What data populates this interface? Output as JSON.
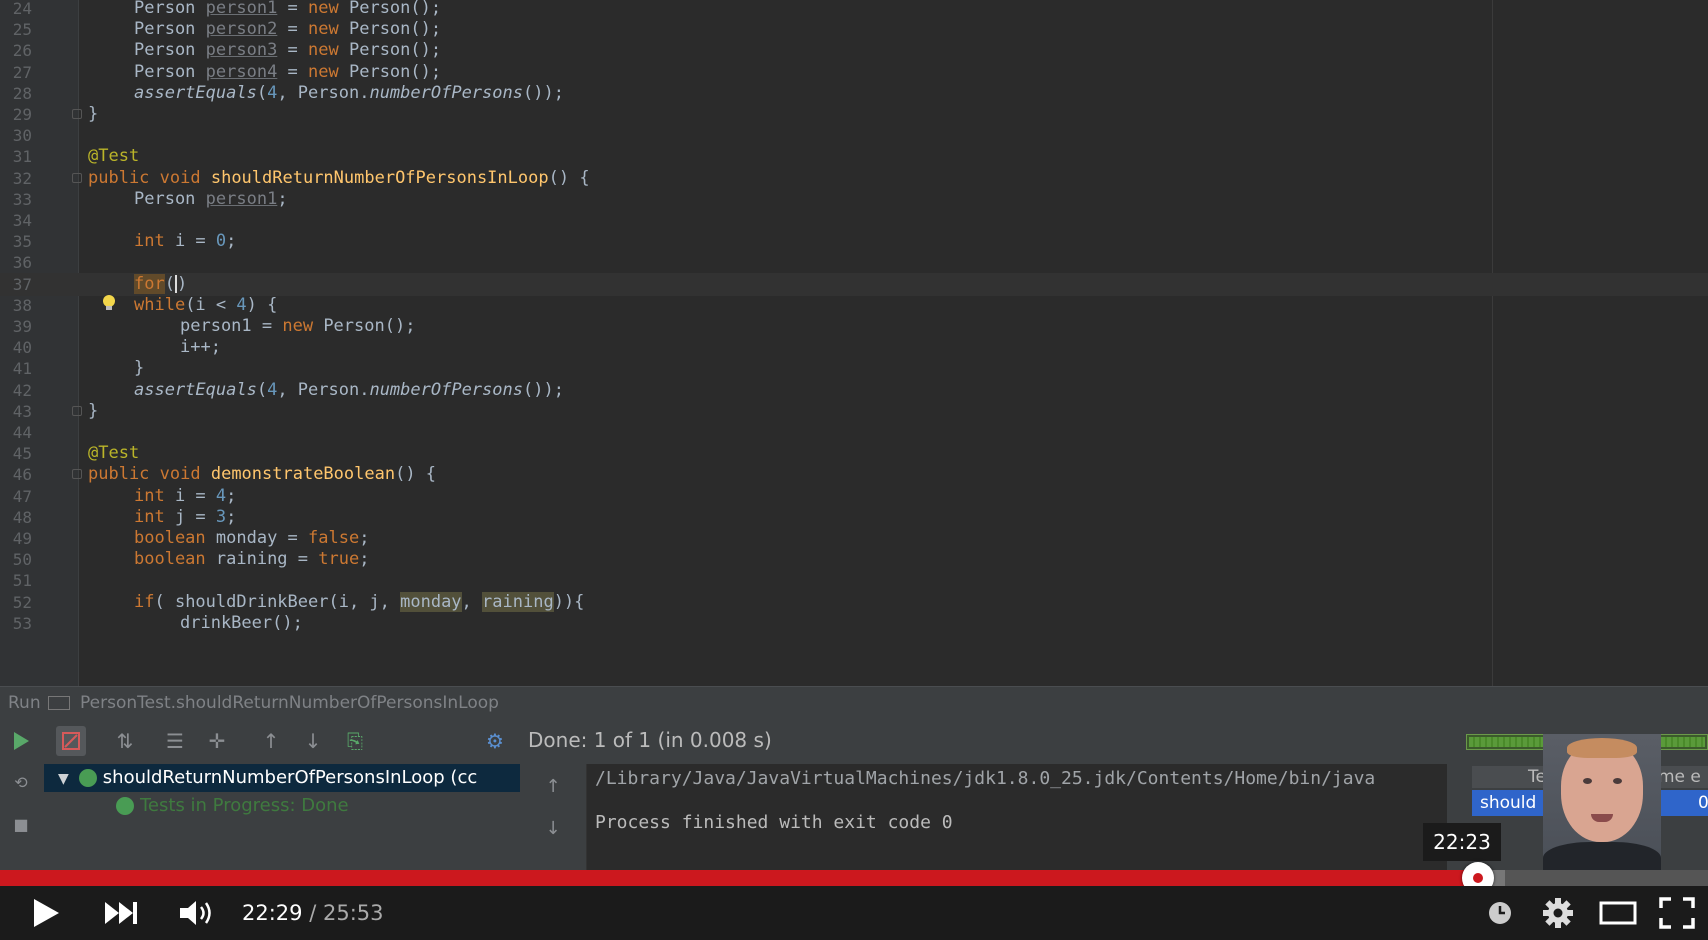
{
  "editor": {
    "lines": [
      {
        "n": "24",
        "html": "Person <span class=\"unused\">person1</span> = <span class=\"kw\">new</span> Person();",
        "indent": 2
      },
      {
        "n": "25",
        "html": "Person <span class=\"unused\">person2</span> = <span class=\"kw\">new</span> Person();",
        "indent": 2
      },
      {
        "n": "26",
        "html": "Person <span class=\"unused\">person3</span> = <span class=\"kw\">new</span> Person();",
        "indent": 2
      },
      {
        "n": "27",
        "html": "Person <span class=\"unused\">person4</span> = <span class=\"kw\">new</span> Person();",
        "indent": 2
      },
      {
        "n": "28",
        "html": "<span class=\"it\">assertEquals</span>(<span class=\"num\">4</span>, Person.<span class=\"it\">numberOfPersons</span>());",
        "indent": 2
      },
      {
        "n": "29",
        "html": "}",
        "indent": 1
      },
      {
        "n": "30",
        "html": "",
        "indent": 0
      },
      {
        "n": "31",
        "html": "<span class=\"ann\">@Test</span>",
        "indent": 1
      },
      {
        "n": "32",
        "html": "<span class=\"kw\">public void</span> <span class=\"fn\">shouldReturnNumberOfPersonsInLoop</span>() {",
        "indent": 1
      },
      {
        "n": "33",
        "html": "Person <span class=\"unused\">person1</span>;",
        "indent": 2
      },
      {
        "n": "34",
        "html": "",
        "indent": 0
      },
      {
        "n": "35",
        "html": "<span class=\"kw\">int</span> i = <span class=\"num\">0</span>;",
        "indent": 2
      },
      {
        "n": "36",
        "html": "",
        "indent": 0
      },
      {
        "n": "37",
        "html": "<span class=\"kw err-hl\">for</span>(<span class=\"caret\"></span>)",
        "indent": 2,
        "current": true
      },
      {
        "n": "38",
        "html": "<span class=\"kw\">while</span>(i &lt; <span class=\"num\">4</span>) {",
        "indent": 2
      },
      {
        "n": "39",
        "html": "person1 = <span class=\"kw\">new</span> Person();",
        "indent": 3
      },
      {
        "n": "40",
        "html": "i++;",
        "indent": 3
      },
      {
        "n": "41",
        "html": "}",
        "indent": 2
      },
      {
        "n": "42",
        "html": "<span class=\"it\">assertEquals</span>(<span class=\"num\">4</span>, Person.<span class=\"it\">numberOfPersons</span>());",
        "indent": 2
      },
      {
        "n": "43",
        "html": "}",
        "indent": 1
      },
      {
        "n": "44",
        "html": "",
        "indent": 0
      },
      {
        "n": "45",
        "html": "<span class=\"ann\">@Test</span>",
        "indent": 1
      },
      {
        "n": "46",
        "html": "<span class=\"kw\">public void</span> <span class=\"fn\">demonstrateBoolean</span>() {",
        "indent": 1
      },
      {
        "n": "47",
        "html": "<span class=\"kw\">int</span> i = <span class=\"num\">4</span>;",
        "indent": 2
      },
      {
        "n": "48",
        "html": "<span class=\"kw\">int</span> j = <span class=\"num\">3</span>;",
        "indent": 2
      },
      {
        "n": "49",
        "html": "<span class=\"kw\">boolean</span> monday = <span class=\"kw\">false</span>;",
        "indent": 2
      },
      {
        "n": "50",
        "html": "<span class=\"kw\">boolean</span> raining = <span class=\"kw\">true</span>;",
        "indent": 2
      },
      {
        "n": "51",
        "html": "",
        "indent": 0
      },
      {
        "n": "52",
        "html": "<span class=\"kw\">if</span>( shouldDrinkBeer(i, j, <span class=\"hl\">monday</span>, <span class=\"hl\">raining</span>)){",
        "indent": 2
      },
      {
        "n": "53",
        "html": "drinkBeer();",
        "indent": 3
      }
    ]
  },
  "run_bar": {
    "label": "Run",
    "config": "PersonTest.shouldReturnNumberOfPersonsInLoop"
  },
  "run_panel": {
    "status": "Done: 1 of 1 (in 0.008 s)",
    "tree": {
      "root": "shouldReturnNumberOfPersonsInLoop (cc",
      "child": "Tests in Progress: Done"
    },
    "console": {
      "line1": "/Library/Java/JavaVirtualMachines/jdk1.8.0_25.jdk/Contents/Home/bin/java",
      "line2": "Process finished with exit code 0"
    },
    "side_table": {
      "header_left": "Te",
      "header_right": "me e",
      "row_left": "should",
      "row_right": "0"
    }
  },
  "player": {
    "tooltip": "22:23",
    "current_time": "22:29",
    "separator": " / ",
    "duration": "25:53",
    "progress_fraction": 0.8655,
    "colors": {
      "played": "#cc181e",
      "bar_bg": "#1b1b1b"
    }
  }
}
